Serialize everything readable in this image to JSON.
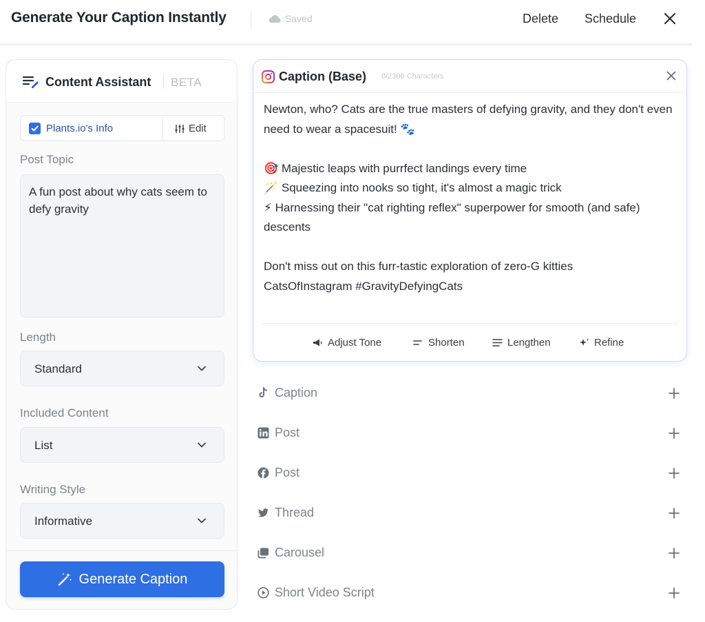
{
  "header": {
    "title": "Generate Your Caption Instantly",
    "saved": "Saved",
    "delete": "Delete",
    "schedule": "Schedule"
  },
  "assistant": {
    "title": "Content Assistant",
    "badge": "BETA",
    "info_label": "Plants.io's Info",
    "info_checked": true,
    "edit": "Edit",
    "post_topic_label": "Post Topic",
    "post_topic_value": "A fun post about why cats seem to defy gravity",
    "length_label": "Length",
    "length_value": "Standard",
    "included_label": "Included Content",
    "included_value": "List",
    "style_label": "Writing Style",
    "style_value": "Informative",
    "generate": "Generate Caption",
    "accent": "#2f6fe4"
  },
  "caption": {
    "title": "Caption (Base)",
    "count": "0/2300 Characters",
    "lines": [
      "Newton, who? Cats are the true masters of defying gravity, and they don't even need to wear a spacesuit! 🐾",
      "",
      "🎯 Majestic leaps with purrfect landings every time",
      "🪄 Squeezing into nooks so tight, it's almost a magic trick",
      "⚡ Harnessing their \"cat righting reflex\" superpower for smooth (and safe) descents",
      "",
      "Don't miss out on this furr-tastic exploration of zero-G kitties",
      "CatsOfInstagram #GravityDefyingCats"
    ],
    "tools": {
      "adjust_tone": "Adjust Tone",
      "shorten": "Shorten",
      "lengthen": "Lengthen",
      "refine": "Refine"
    }
  },
  "platforms": [
    {
      "icon": "tiktok-icon",
      "label": "Caption"
    },
    {
      "icon": "linkedin-icon",
      "label": "Post"
    },
    {
      "icon": "facebook-icon",
      "label": "Post"
    },
    {
      "icon": "twitter-icon",
      "label": "Thread"
    },
    {
      "icon": "carousel-icon",
      "label": "Carousel"
    },
    {
      "icon": "play-circle-icon",
      "label": "Short Video Script"
    }
  ]
}
